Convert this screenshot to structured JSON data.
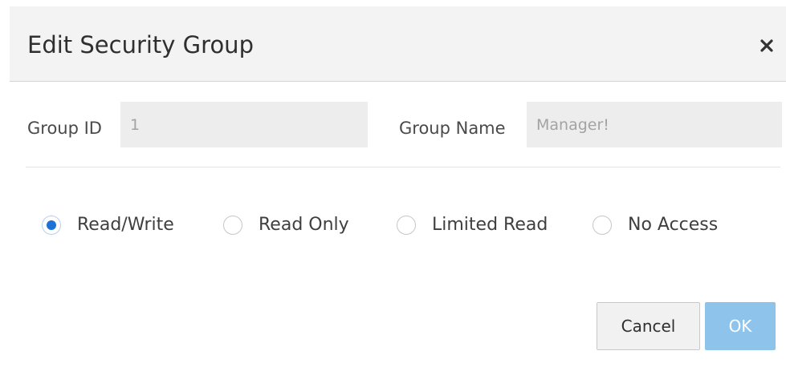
{
  "dialog": {
    "title": "Edit Security Group",
    "close_icon": "close-icon"
  },
  "fields": {
    "group_id": {
      "label": "Group ID",
      "value": "1"
    },
    "group_name": {
      "label": "Group Name",
      "value": "Manager!"
    }
  },
  "access": {
    "selected": "Read/Write",
    "options": [
      {
        "label": "Read/Write",
        "checked": true
      },
      {
        "label": "Read Only",
        "checked": false
      },
      {
        "label": "Limited Read",
        "checked": false
      },
      {
        "label": "No Access",
        "checked": false
      }
    ]
  },
  "buttons": {
    "cancel_label": "Cancel",
    "ok_label": "OK"
  },
  "colors": {
    "accent": "#1c73d4",
    "ok_button": "#8ec4ec",
    "header_bg": "#f3f3f3"
  }
}
